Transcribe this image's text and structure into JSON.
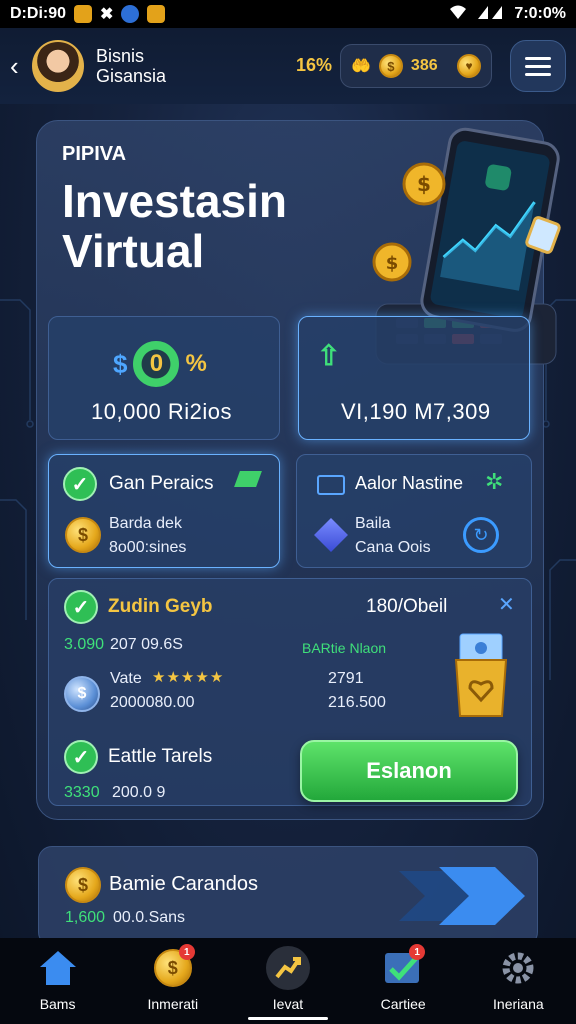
{
  "status_bar": {
    "time_left": "D:Di:90",
    "time_right": "7:0:0%"
  },
  "header": {
    "profile_line1": "Bisnis",
    "profile_line2": "Gisansia",
    "percent": "16%",
    "coin_amount": "386"
  },
  "hero": {
    "eyebrow": "PIPIVA",
    "title_line1": "Investasin",
    "title_line2": "Virtual"
  },
  "stat_cards": [
    {
      "symbol_left": "$",
      "symbol_mid": "0",
      "symbol_right": "%",
      "value": "10,000 Ri2ios"
    },
    {
      "value": "VI,190 M7,309"
    }
  ],
  "feature_cards": [
    {
      "title": "Gan Peraics",
      "line1": "Barda dek",
      "line2": "8o00:sines"
    },
    {
      "title": "Aalor Nastine",
      "line1": "Baila",
      "line2": "Cana Oois"
    }
  ],
  "details": {
    "row1_title": "Zudin Geyb",
    "row1_right": "180/Obeil",
    "row1_sub_green": "3.090",
    "row1_sub": "207 09.6S",
    "rating_label": "Vate",
    "rating_stars": 5,
    "rating_value": "2000080.00",
    "mid_green_label": "BARtie Nlaon",
    "mid_value1": "2791",
    "mid_value2": "216.500",
    "row3_title": "Eattle Tarels",
    "row3_sub_green": "3330",
    "row3_sub": "200.0 9",
    "cta_label": "Eslanon"
  },
  "bottom_card": {
    "title": "Bamie Carandos",
    "sub_green": "1,600",
    "sub": "00.0.Sans"
  },
  "nav": [
    {
      "label": "Bams",
      "icon": "home-icon",
      "badge": ""
    },
    {
      "label": "Inmerati",
      "icon": "coin-hand-icon",
      "badge": "1"
    },
    {
      "label": "Ievat",
      "icon": "chart-up-icon",
      "badge": ""
    },
    {
      "label": "Cartiee",
      "icon": "checklist-icon",
      "badge": "1"
    },
    {
      "label": "Ineriana",
      "icon": "gear-icon",
      "badge": ""
    }
  ],
  "colors": {
    "accent_green": "#3fe07a",
    "gold": "#f4c542",
    "cta_green": "#2fbf55",
    "background": "#15223d"
  }
}
